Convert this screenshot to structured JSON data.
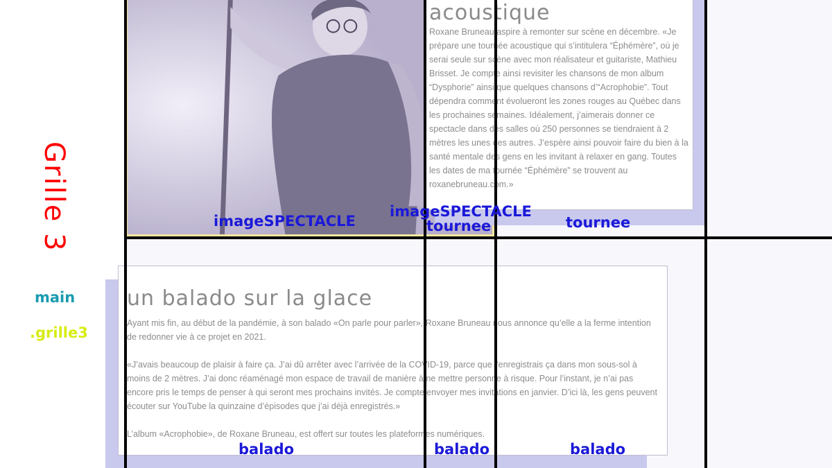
{
  "sidebar": {
    "grid_title": "Grille 3",
    "element_label": "main",
    "class_label": ".grille3"
  },
  "tournee": {
    "heading": "acoustique",
    "body": "Roxane Bruneau aspire à remonter sur scène en décembre. «Je prépare une tournée acoustique qui s’intitulera “Éphémère”, où je serai seule sur scène avec mon réalisateur et guitariste, Mathieu Brisset. Je compte ainsi revisiter les chansons de mon album “Dysphorie” ainsi que quelques chansons d’“Acrophobie”. Tout dépendra comment évolueront les zones rouges au Québec dans les prochaines semaines. Idéalement, j’aimerais donner ce spectacle dans des salles où 250 personnes se tiendraient à 2 mètres les unes des autres. J’espère ainsi pouvoir faire du bien à la santé mentale des gens en les invitant à relaxer en gang. Toutes les dates de ma tournée “Éphémère” se trouvent au roxanebruneau.com.»"
  },
  "balado": {
    "heading": "un balado sur la glace",
    "paragraphs": [
      "Ayant mis fin, au début de la pandémie, à son balado «On parle pour parler», Roxane Bruneau nous annonce qu’elle a la ferme intention de redonner vie à ce projet en 2021.",
      "«J’avais beaucoup de plaisir à faire ça. J’ai dû arrêter avec l’arrivée de la COVID-19, parce que j’enregistrais ça dans mon sous-sol à moins de 2 mètres. J’ai donc réaménagé mon espace de travail de manière à ne mettre personne à risque. Pour l’instant, je n’ai pas encore pris le temps de penser à qui seront mes prochains invités. Je compte envoyer mes invitations en janvier. D’ici là, les gens peuvent écouter sur YouTube la quinzaine d’épisodes que j’ai déjà enregistrés.»",
      "L’album «Acrophobie», de Roxane Bruneau, est offert sur toutes les plateformes numériques."
    ]
  },
  "area_labels": {
    "image_1": "imageSPECTACLE",
    "image_2": "imageSPECTACLE",
    "tournee_1": "tournee",
    "tournee_2": "tournee",
    "balado_1": "balado",
    "balado_2": "balado",
    "balado_3": "balado"
  },
  "colors": {
    "grid_title": "#ff0000",
    "element_label": "#1a9bb0",
    "class_label": "#d7ec12",
    "area_label": "#1b19d8",
    "grid_line": "#000000",
    "card_shadow": "#c9c9ee"
  }
}
